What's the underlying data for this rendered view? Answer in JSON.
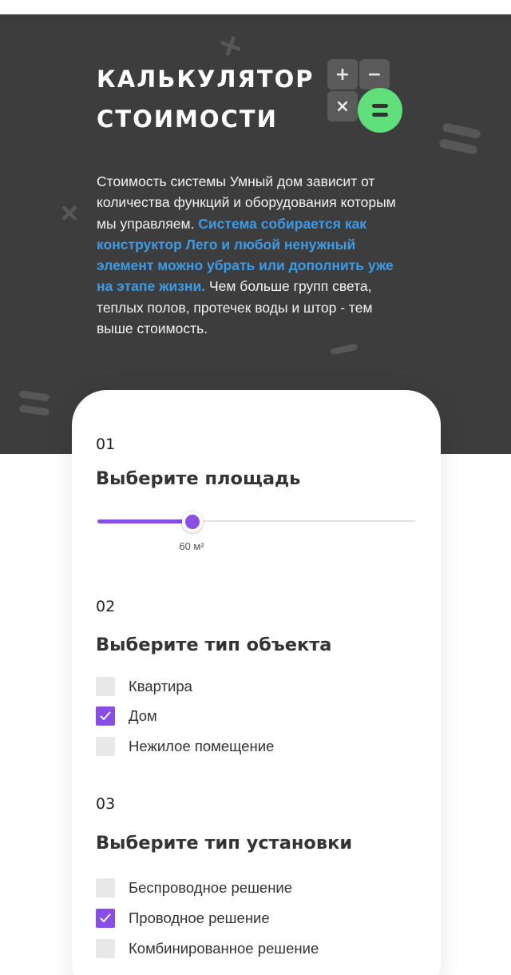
{
  "hero": {
    "title_line1": "Калькулятор",
    "title_line2": "стоимости",
    "calc_keys": [
      "+",
      "−",
      "×"
    ],
    "desc_before": "Стоимость системы Умный дом зависит от количества функций и оборудования которым мы управляем.",
    "desc_highlight": "Система собирается как конструктор Лего и любой ненужный элемент можно убрать или дополнить уже на этапе жизни.",
    "desc_after": "Чем больше групп света, теплых полов, протечек воды и штор - тем выше стоимость."
  },
  "steps": {
    "area": {
      "number": "01",
      "title": "Выберите площадь",
      "slider_fraction": 0.3,
      "value_label": "60 м²"
    },
    "object_type": {
      "number": "02",
      "title": "Выберите тип объекта",
      "options": [
        {
          "label": "Квартира",
          "checked": false
        },
        {
          "label": "Дом",
          "checked": true
        },
        {
          "label": "Нежилое помещение",
          "checked": false
        }
      ]
    },
    "install_type": {
      "number": "03",
      "title": "Выберите тип установки",
      "options": [
        {
          "label": "Беспроводное решение",
          "checked": false
        },
        {
          "label": "Проводное решение",
          "checked": true
        },
        {
          "label": "Комбинированное решение",
          "checked": false
        }
      ]
    }
  },
  "colors": {
    "accent": "#8b4de8",
    "highlight": "#3c9be6",
    "hero_bg": "#3d3d3d",
    "calc_green": "#5fe07a"
  }
}
